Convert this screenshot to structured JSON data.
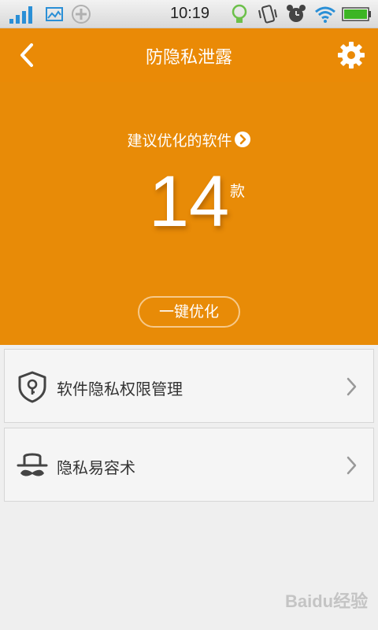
{
  "status_bar": {
    "time": "10:19",
    "icons": [
      "signal-icon",
      "image-icon",
      "sync-icon",
      "bulb-icon",
      "vibrate-icon",
      "alarm-icon",
      "wifi-icon",
      "battery-icon"
    ]
  },
  "header": {
    "title": "防隐私泄露",
    "back_icon": "chevron-left-icon",
    "settings_icon": "gear-icon"
  },
  "hero": {
    "suggest_label": "建议优化的软件",
    "count": "14",
    "count_unit": "款",
    "optimize_button": "一键优化"
  },
  "menu": [
    {
      "label": "软件隐私权限管理",
      "icon": "shield-key-icon"
    },
    {
      "label": "隐私易容术",
      "icon": "disguise-icon"
    }
  ],
  "watermark": "Baidu经验",
  "colors": {
    "brand_orange": "#ea8a06",
    "background": "#efefef",
    "text_dark": "#333333"
  }
}
